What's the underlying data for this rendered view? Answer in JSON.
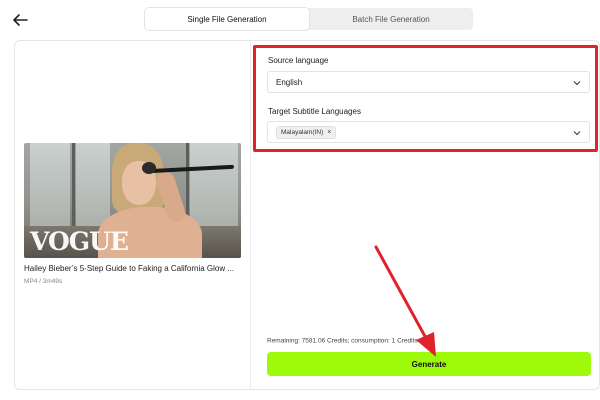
{
  "tabs": [
    {
      "label": "Single File Generation",
      "active": true
    },
    {
      "label": "Batch File Generation",
      "active": false
    }
  ],
  "video": {
    "watermark": "VOGUE",
    "title": "Hailey Bieber’s 5-Step Guide to Faking a California Glow ...",
    "meta": "MP4 / 3m49s"
  },
  "source_language": {
    "label": "Source language",
    "value": "English"
  },
  "target_languages": {
    "label": "Target Subtitle Languages",
    "chips": [
      "Malayalam(IN)"
    ]
  },
  "credits": {
    "remaining_text": "Remaining: 7581.06 Credits; consumption: 1 Credits"
  },
  "generate_label": "Generate",
  "colors": {
    "accent_button": "#9dfa0b",
    "highlight": "#e0232b"
  },
  "icons": {
    "back": "arrow-left-icon",
    "dropdown": "chevron-down-icon",
    "remove_chip": "close-icon",
    "info": "info-icon"
  }
}
